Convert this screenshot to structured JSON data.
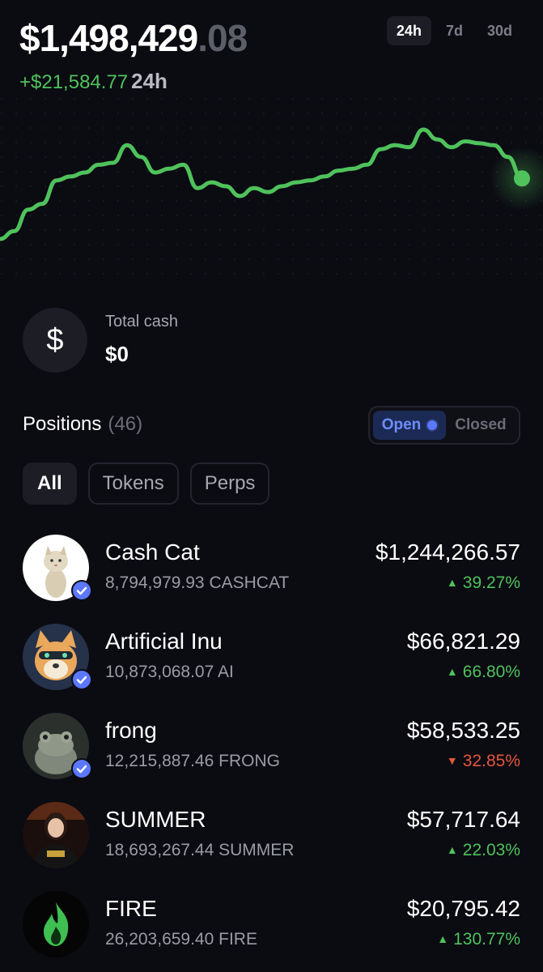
{
  "header": {
    "balance_main": "$1,498,429",
    "balance_cents": ".08",
    "change_amount": "+$21,584.77",
    "change_period": "24h"
  },
  "range_tabs": [
    {
      "label": "24h",
      "active": true
    },
    {
      "label": "7d",
      "active": false
    },
    {
      "label": "30d",
      "active": false
    }
  ],
  "chart_data": {
    "type": "line",
    "series": [
      {
        "values": [
          40,
          44,
          55,
          58,
          70,
          72,
          74,
          78,
          79,
          88,
          82,
          74,
          76,
          78,
          66,
          69,
          67,
          62,
          66,
          64,
          67,
          69,
          70,
          72,
          75,
          76,
          78,
          86,
          88,
          87,
          96,
          91,
          87,
          90,
          89,
          88,
          82,
          71
        ]
      }
    ],
    "grid": false,
    "colors": {
      "line": "#4fc25c"
    }
  },
  "cash": {
    "icon": "dollar-icon",
    "label": "Total cash",
    "value": "$0"
  },
  "positions": {
    "title": "Positions",
    "count": "(46)",
    "toggle": {
      "open": "Open",
      "closed": "Closed"
    },
    "filters": [
      {
        "label": "All",
        "active": true
      },
      {
        "label": "Tokens",
        "active": false
      },
      {
        "label": "Perps",
        "active": false
      }
    ],
    "items": [
      {
        "name": "Cash Cat",
        "qty": "8,794,979.93 CASHCAT",
        "value": "$1,244,266.57",
        "change": "39.27%",
        "direction": "up",
        "verified": true,
        "icon": "cat-avatar"
      },
      {
        "name": "Artificial Inu",
        "qty": "10,873,068.07 AI",
        "value": "$66,821.29",
        "change": "66.80%",
        "direction": "up",
        "verified": true,
        "icon": "dog-avatar"
      },
      {
        "name": "frong",
        "qty": "12,215,887.46 FRONG",
        "value": "$58,533.25",
        "change": "32.85%",
        "direction": "down",
        "verified": true,
        "icon": "frog-avatar"
      },
      {
        "name": "SUMMER",
        "qty": "18,693,267.44 SUMMER",
        "value": "$57,717.64",
        "change": "22.03%",
        "direction": "up",
        "verified": false,
        "icon": "person-avatar"
      },
      {
        "name": "FIRE",
        "qty": "26,203,659.40 FIRE",
        "value": "$20,795.42",
        "change": "130.77%",
        "direction": "up",
        "verified": false,
        "icon": "flame-avatar"
      }
    ]
  },
  "colors": {
    "background": "#0b0b12",
    "positive": "#4fc25c",
    "negative": "#e4573b",
    "accent": "#5b78ff"
  }
}
